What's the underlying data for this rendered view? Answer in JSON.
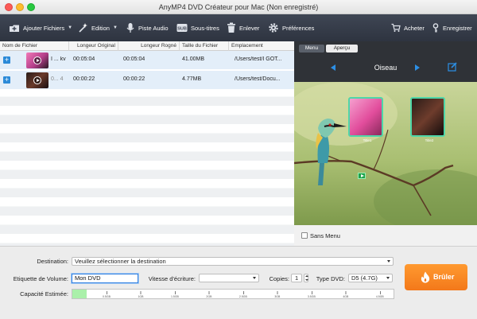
{
  "window": {
    "title": "AnyMP4 DVD Créateur pour Mac (Non enregistré)"
  },
  "toolbar": {
    "add_files": "Ajouter Fichiers",
    "edit": "Edition",
    "audio_track": "Piste Audio",
    "subtitles": "Sous-titres",
    "remove": "Enlever",
    "preferences": "Préférences",
    "buy": "Acheter",
    "register": "Enregistrer"
  },
  "file_list": {
    "columns": [
      "Nom de Fichier",
      "Longeur Original",
      "Longeur Rogné",
      "Taille du Fichier",
      "Emplacement"
    ],
    "rows": [
      {
        "name": "I ... kv",
        "original_length": "00:05:04",
        "trimmed_length": "00:05:04",
        "size": "41.00MB",
        "location": "/Users/test/I GOT...",
        "dim_name": false
      },
      {
        "name": "0... 4",
        "original_length": "00:00:22",
        "trimmed_length": "00:00:22",
        "size": "4.77MB",
        "location": "/Users/test/Docu...",
        "dim_name": true
      }
    ]
  },
  "menu_panel": {
    "tabs": [
      "Menu",
      "Aperçu"
    ],
    "active_tab": "Menu",
    "template_name": "Oiseau",
    "thumb_captions": [
      "Title1",
      "Title2"
    ],
    "no_menu_label": "Sans Menu",
    "no_menu_checked": false
  },
  "settings": {
    "destination_label": "Destination:",
    "destination_value": "Veuillez sélectionner la destination",
    "volume_label_label": "Etiquette de Volume:",
    "volume_label_value": "Mon DVD",
    "write_speed_label": "Vitesse d'écriture:",
    "write_speed_value": "",
    "copies_label": "Copies:",
    "copies_value": "1",
    "dvd_type_label": "Type DVD:",
    "dvd_type_value": "D5 (4.7G)",
    "capacity_label": "Capacité Estimée:",
    "capacity_fraction": 0.045,
    "capacity_ticks": [
      "0.5GB",
      "1GB",
      "1.5GB",
      "2GB",
      "2.5GB",
      "3GB",
      "3.5GB",
      "4GB",
      "4.5GB"
    ]
  },
  "burn_button": {
    "label": "Brûler",
    "color": "#f3781a"
  },
  "colors": {
    "toolbar": "#353b47",
    "accent": "#2c8fe5",
    "thumb_border": "#4fd6a8"
  }
}
